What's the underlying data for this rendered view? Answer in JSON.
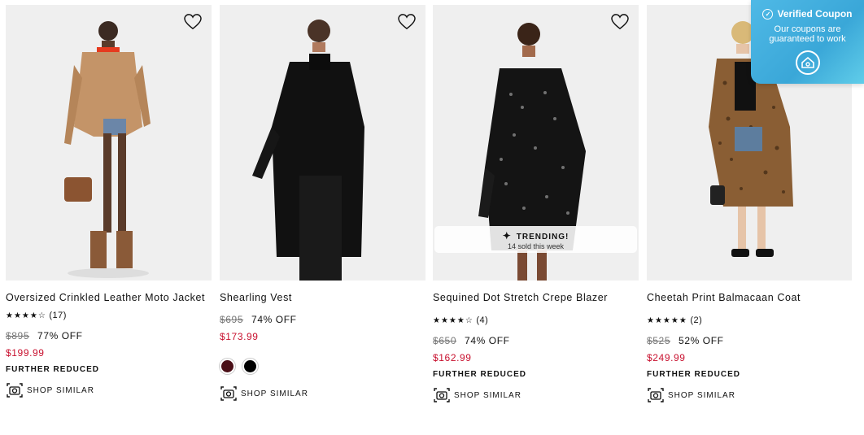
{
  "products": [
    {
      "title": "Oversized Crinkled Leather Moto Jacket",
      "stars": "★★★★☆",
      "reviews": "(17)",
      "was": "$895",
      "off": "77% OFF",
      "sale": "$199.99",
      "badge": "FURTHER REDUCED",
      "shop_similar": "SHOP SIMILAR"
    },
    {
      "title": "Shearling Vest",
      "was": "$695",
      "off": "74% OFF",
      "sale": "$173.99",
      "swatches": [
        "#4a0f17",
        "#000000"
      ],
      "shop_similar": "SHOP SIMILAR"
    },
    {
      "title": "Sequined Dot Stretch Crepe Blazer",
      "stars": "★★★★☆",
      "reviews": "(4)",
      "was": "$650",
      "off": "74% OFF",
      "sale": "$162.99",
      "badge": "FURTHER REDUCED",
      "shop_similar": "SHOP SIMILAR",
      "trending": {
        "label": "TRENDING!",
        "sub": "14 sold this week"
      }
    },
    {
      "title": "Cheetah Print Balmacaan Coat",
      "stars": "★★★★★",
      "reviews": "(2)",
      "was": "$525",
      "off": "52% OFF",
      "sale": "$249.99",
      "badge": "FURTHER REDUCED",
      "shop_similar": "SHOP SIMILAR"
    }
  ],
  "coupon": {
    "title": "Verified Coupon",
    "text": "Our coupons are guaranteed to work"
  },
  "colors": {
    "sale": "#c8102e",
    "coupon": "#3aa7d8"
  }
}
